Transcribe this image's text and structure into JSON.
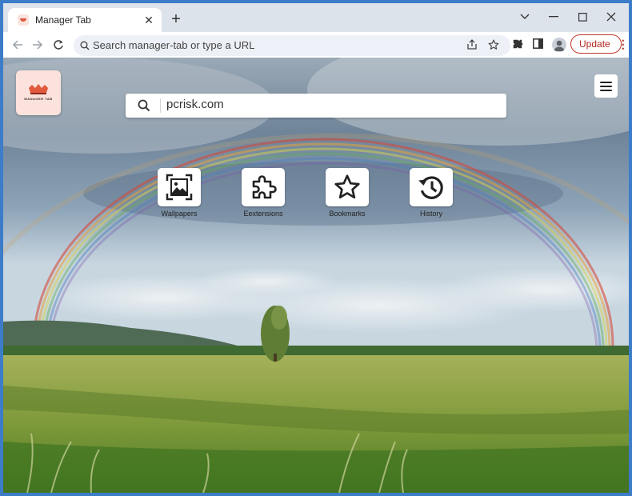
{
  "tab": {
    "title": "Manager Tab",
    "close_icon": "close-icon",
    "new_tab_icon": "plus-icon"
  },
  "window_controls": [
    "minimize",
    "maximize",
    "close"
  ],
  "omnibox": {
    "placeholder": "Search manager-tab or type a URL"
  },
  "toolbar": {
    "update_label": "Update"
  },
  "logo": {
    "text": "MANAGER TAB",
    "color": "#fbe2dc"
  },
  "search": {
    "value": "pcrisk.com"
  },
  "tiles": [
    {
      "label": "Wallpapers",
      "icon": "image-icon"
    },
    {
      "label": "Eextensions",
      "icon": "puzzle-icon"
    },
    {
      "label": "Bookmarks",
      "icon": "star-icon"
    },
    {
      "label": "History",
      "icon": "history-icon"
    }
  ],
  "colors": {
    "accent": "#b3261e",
    "frame": "#3d7cc9"
  }
}
